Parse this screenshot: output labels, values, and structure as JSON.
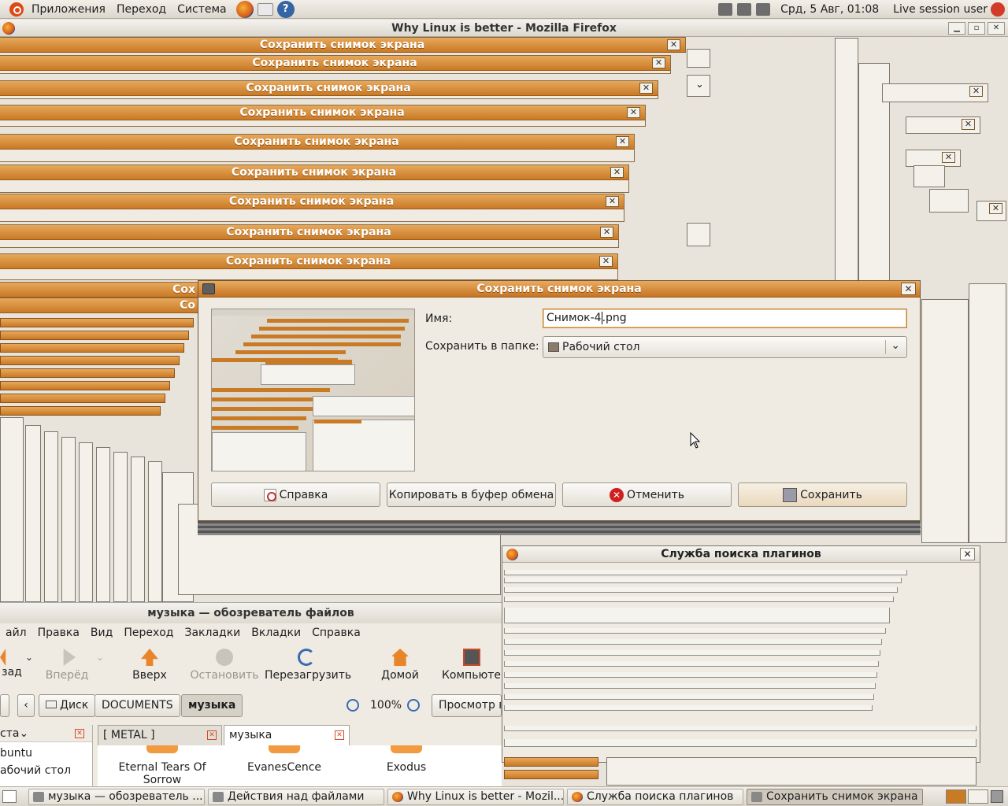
{
  "top_panel": {
    "menus": [
      "Приложения",
      "Переход",
      "Система"
    ],
    "clock": "Срд,  5 Авг, 01:08",
    "user": "Live session user"
  },
  "firefox": {
    "title": "Why Linux is better - Mozilla Firefox"
  },
  "trail_title": "Сохранить снимок экрана",
  "trail_partial": [
    "Сох",
    "Со"
  ],
  "dialog": {
    "title": "Сохранить снимок экрана",
    "name_label": "Имя:",
    "name_before_caret": "Снимок-4",
    "name_after_caret": ".png",
    "folder_label": "Сохранить в папке:",
    "folder_value": "Рабочий стол",
    "buttons": {
      "help": "Справка",
      "copy": "Копировать в буфер обмена",
      "cancel": "Отменить",
      "save": "Сохранить"
    }
  },
  "plugin_window": {
    "title": "Служба поиска плагинов"
  },
  "file_manager": {
    "title": "музыка — обозреватель файлов",
    "menu": [
      "айл",
      "Правка",
      "Вид",
      "Переход",
      "Закладки",
      "Вкладки",
      "Справка"
    ],
    "tools": {
      "back": "зад",
      "forward": "Вперёд",
      "up": "Вверх",
      "stop": "Остановить",
      "reload": "Перезагрузить",
      "home": "Домой",
      "computer": "Компьюте"
    },
    "location": {
      "disk": "Диск",
      "documents": "DOCUMENTS",
      "music": "музыка",
      "zoom": "100%",
      "view": "Просмотр в"
    },
    "side_header": "ста",
    "side_items": [
      "buntu",
      "абочий стол"
    ],
    "tabs": [
      "[ METAL ]",
      "музыка"
    ],
    "items": [
      "Eternal Tears Of Sorrow",
      "EvanesCence",
      "Exodus"
    ]
  },
  "taskbar": {
    "tasks": [
      "музыка — обозреватель ...",
      "Действия над файлами",
      "Why Linux is better - Mozil...",
      "Служба поиска плагинов",
      "Сохранить снимок экрана"
    ]
  },
  "colors": {
    "accent_orange": "#c97a25",
    "panel": "#dcd7cd",
    "window_bg": "#efebe2"
  }
}
